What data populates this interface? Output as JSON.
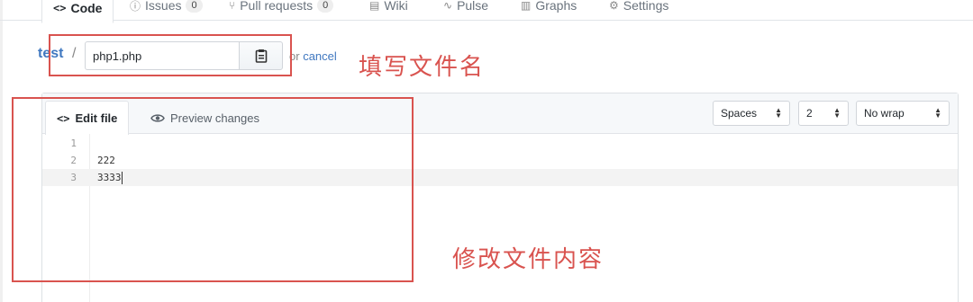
{
  "repo_nav": {
    "tabs": [
      {
        "label": "Code",
        "icon": "code-icon",
        "count": null,
        "selected": true
      },
      {
        "label": "Issues",
        "icon": "issue-icon",
        "count": "0",
        "selected": false
      },
      {
        "label": "Pull requests",
        "icon": "pull-request-icon",
        "count": "0",
        "selected": false
      },
      {
        "label": "Wiki",
        "icon": "book-icon",
        "count": null,
        "selected": false
      },
      {
        "label": "Pulse",
        "icon": "pulse-icon",
        "count": null,
        "selected": false
      },
      {
        "label": "Graphs",
        "icon": "graph-icon",
        "count": null,
        "selected": false
      },
      {
        "label": "Settings",
        "icon": "gear-icon",
        "count": null,
        "selected": false
      }
    ]
  },
  "breadcrumb": {
    "repo": "test",
    "separator": "/",
    "filename_value": "php1.php",
    "or_text": "or",
    "cancel_label": "cancel"
  },
  "annotations": {
    "filename_note": "填写文件名",
    "content_note": "修改文件内容",
    "color": "#d9534f"
  },
  "editor": {
    "tabs": {
      "edit_label": "Edit file",
      "preview_label": "Preview changes"
    },
    "indent_mode": "Spaces",
    "indent_size": "2",
    "wrap_mode": "No wrap",
    "lines": [
      {
        "num": "1",
        "code": ""
      },
      {
        "num": "2",
        "code": "222"
      },
      {
        "num": "3",
        "code": "3333"
      }
    ],
    "current_line": 3
  },
  "colors": {
    "link": "#4078c0",
    "selected_tab_accent": "#e36209"
  }
}
